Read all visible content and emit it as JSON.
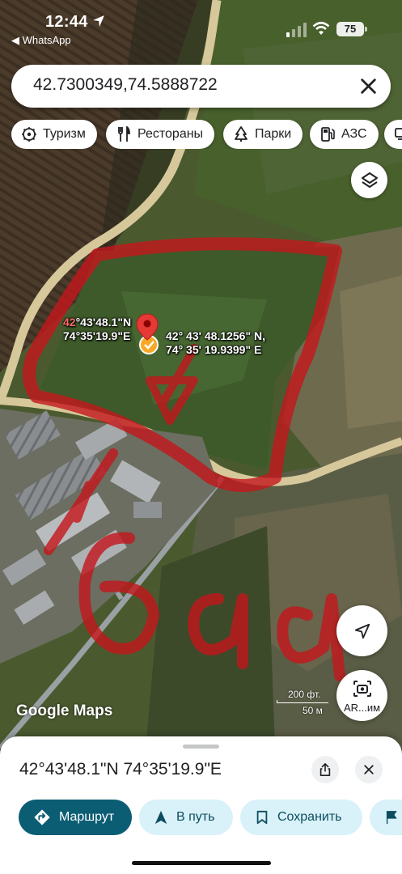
{
  "status_bar": {
    "time": "12:44",
    "back_app": "◀ WhatsApp",
    "battery": "75"
  },
  "search": {
    "query": "42.7300349,74.5888722"
  },
  "chips": [
    {
      "label": "Туризм",
      "icon": "attraction-icon"
    },
    {
      "label": "Рестораны",
      "icon": "restaurant-icon"
    },
    {
      "label": "Парки",
      "icon": "park-icon"
    },
    {
      "label": "АЗС",
      "icon": "gas-station-icon"
    }
  ],
  "map": {
    "pin_label_lat_prefix": "42",
    "pin_label_lat_rest": "°43'48.1\"N",
    "pin_label_lon": "74°35'19.9\"E",
    "dms_label_line1": "42° 43' 48.1256\" N,",
    "dms_label_line2": "74° 35' 19.9399\" E",
    "attribution": "Google Maps",
    "scale_top": "200 фт.",
    "scale_bottom": "50 м",
    "ar_label": "AR...им",
    "annotation_color": "#d3121c"
  },
  "place": {
    "title": "42°43'48.1\"N 74°35'19.9\"E"
  },
  "actions": [
    {
      "label": "Маршрут",
      "icon": "directions-icon"
    },
    {
      "label": "В путь",
      "icon": "navigation-arrow-icon"
    },
    {
      "label": "Сохранить",
      "icon": "bookmark-icon"
    }
  ],
  "colors": {
    "primary_button": "#0b5d74",
    "secondary_button": "#d9f1f8",
    "pin_red": "#e53935"
  }
}
